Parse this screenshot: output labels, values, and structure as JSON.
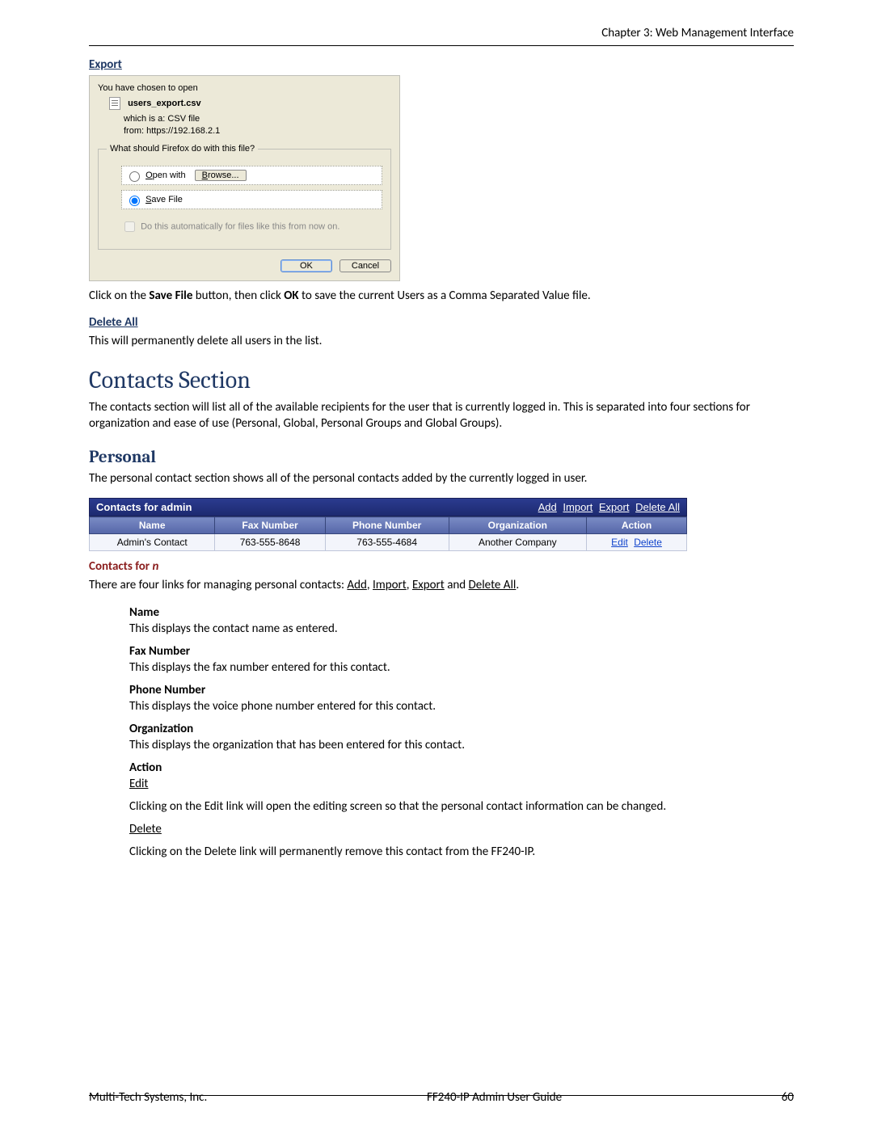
{
  "header": {
    "running": "Chapter 3: Web Management Interface"
  },
  "footer": {
    "company": "Multi-Tech Systems, Inc.",
    "guide": "FF240-IP Admin User Guide",
    "page": "60"
  },
  "export": {
    "heading": "Export",
    "dialog": {
      "chosen": "You have chosen to open",
      "filename": "users_export.csv",
      "filetype": "which is a:  CSV file",
      "from": "from:  https://192.168.2.1",
      "legend": "What should Firefox do with this file?",
      "open_with": "Open with",
      "browse": "Browse...",
      "save_file": "Save File",
      "auto": "Do this automatically for files like this from now on.",
      "ok": "OK",
      "cancel": "Cancel"
    },
    "caption_pre": "Click on the ",
    "caption_b1": "Save File",
    "caption_mid": " button, then click ",
    "caption_b2": "OK",
    "caption_post": " to save the current Users as a Comma Separated Value file."
  },
  "delete_all": {
    "heading": "Delete All",
    "body": "This will permanently delete all users in the list."
  },
  "contacts_section": {
    "title": "Contacts Section",
    "body": "The contacts section will list all of the available recipients for the user that is currently logged in. This is separated into four sections for organization and ease of use (Personal, Global, Personal Groups and Global Groups)."
  },
  "personal": {
    "title": "Personal",
    "intro": "The personal contact section shows all of the personal contacts added by the currently logged in user.",
    "title_bar": "Contacts for admin",
    "links": {
      "add": "Add",
      "import": "Import",
      "export": "Export",
      "delete_all": "Delete All"
    },
    "columns": {
      "name": "Name",
      "fax": "Fax Number",
      "phone": "Phone Number",
      "org": "Organization",
      "action": "Action"
    },
    "row": {
      "name": "Admin's Contact",
      "fax": "763-555-8648",
      "phone": "763-555-4684",
      "org": "Another Company",
      "edit": "Edit",
      "delete": "Delete"
    }
  },
  "contacts_for_n": {
    "heading_pre": "Contacts for ",
    "heading_em": "n",
    "body_pre": "There are four links for managing personal contacts: ",
    "l1": "Add",
    "l2": "Import",
    "l3": "Export",
    "and": " and ",
    "l4": "Delete All",
    "period": "."
  },
  "definitions": [
    {
      "term": "Name",
      "desc": "This displays the contact name as entered."
    },
    {
      "term": "Fax Number",
      "desc": "This displays the fax number entered for this contact."
    },
    {
      "term": "Phone Number",
      "desc": "This displays the voice phone number entered for this contact."
    },
    {
      "term": "Organization",
      "desc": "This displays the organization that has been entered for this contact."
    }
  ],
  "action_def": {
    "term": "Action",
    "edit_label": "Edit",
    "edit_desc": "Clicking on the Edit link will open the editing screen so that the personal contact information can be changed.",
    "delete_label": "Delete",
    "delete_desc": "Clicking on the Delete link will permanently remove this contact from the FF240-IP."
  }
}
